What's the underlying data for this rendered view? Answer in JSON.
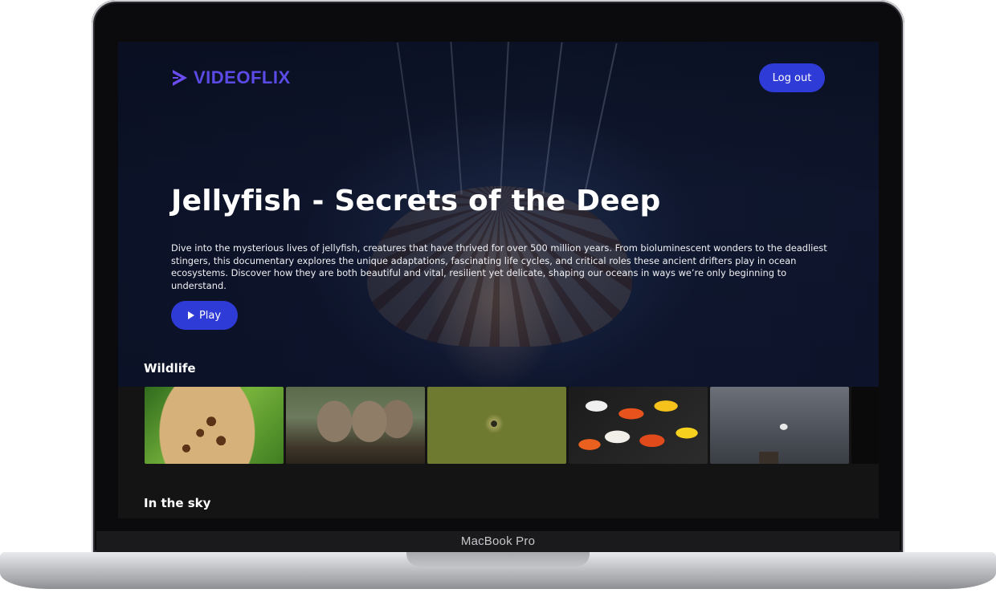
{
  "device": {
    "label": "MacBook Pro"
  },
  "brand": {
    "name": "VIDEOFLIX",
    "accent": "#5b4be6"
  },
  "header": {
    "logout_label": "Log out"
  },
  "hero": {
    "title": "Jellyfish - Secrets of the Deep",
    "description": "Dive into the mysterious lives of jellyfish, creatures that have thrived for over 500 million years. From bioluminescent wonders to the deadliest stingers, this documentary explores the unique adaptations, fascinating life cycles, and critical roles these ancient drifters play in ocean ecosystems. Discover how they are both beautiful and vital, resilient yet delicate, shaping our oceans in ways we’re only beginning to understand.",
    "play_label": "Play"
  },
  "sections": [
    {
      "title": "Wildlife",
      "items": [
        "giraffe",
        "monkeys",
        "chameleon",
        "koi",
        "seagull"
      ]
    },
    {
      "title": "In the sky"
    }
  ],
  "colors": {
    "button": "#2f3bd6",
    "background": "#141414"
  }
}
